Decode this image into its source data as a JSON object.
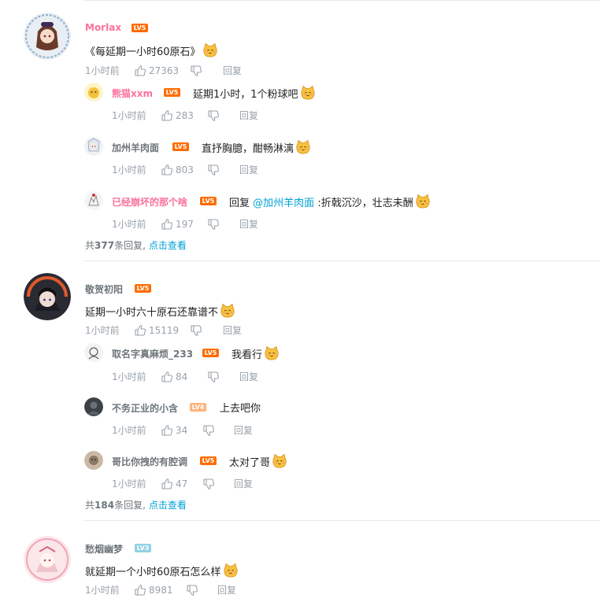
{
  "threads": [
    {
      "user": "Morlax",
      "level": "LV5",
      "comment_pre": "《每延期一小时60原石》",
      "time": "1小时前",
      "likes": "27363",
      "reply_label": "回复",
      "replies": [
        {
          "user": "熊猫xxm",
          "level": "LV5",
          "text": "延期1小时，1个粉球吧",
          "time": "1小时前",
          "likes": "283",
          "reply_label": "回复"
        },
        {
          "user": "加州羊肉面",
          "level": "LV5",
          "text": "直抒胸臆，酣畅淋漓",
          "time": "1小时前",
          "likes": "803",
          "reply_label": "回复"
        },
        {
          "user": "已经崩坏的那个啥",
          "level": "LV5",
          "text_prefix": "回复",
          "mention": "@加州羊肉面",
          "text": ":折戟沉沙，壮志未酬",
          "time": "1小时前",
          "likes": "197",
          "reply_label": "回复"
        }
      ],
      "more_prefix": "共",
      "more_count": "377",
      "more_suffix": "条回复,",
      "more_link": "点击查看"
    },
    {
      "user": "敬贺初阳",
      "level": "LV5",
      "comment_pre": "延期一小时六十原石还靠谱不",
      "time": "1小时前",
      "likes": "15119",
      "reply_label": "回复",
      "replies": [
        {
          "user": "取名字真麻烦_233",
          "level": "LV5",
          "text": "我看行",
          "time": "1小时前",
          "likes": "84",
          "reply_label": "回复"
        },
        {
          "user": "不务正业的小含",
          "level": "LV4",
          "text": "上去吧你",
          "time": "1小时前",
          "likes": "34",
          "reply_label": "回复"
        },
        {
          "user": "哥比你拽的有腔调",
          "level": "LV5",
          "text": "太对了哥",
          "time": "1小时前",
          "likes": "47",
          "reply_label": "回复"
        }
      ],
      "more_prefix": "共",
      "more_count": "184",
      "more_suffix": "条回复,",
      "more_link": "点击查看"
    },
    {
      "user": "愁烟幽梦",
      "level": "LV3",
      "comment_pre": "就延期一个小时60原石怎么样",
      "time": "1小时前",
      "likes": "8981",
      "reply_label": "回复"
    }
  ],
  "colors": {
    "pink_name": "#fb7299",
    "gray_name": "#6d757a",
    "meta": "#99a2aa",
    "link": "#00a1d6",
    "lv5": "#ff6c00",
    "lv4": "#ffb37c",
    "lv3": "#92d1e5"
  },
  "icons": {
    "like": "thumb-up-icon",
    "dislike": "thumb-down-icon",
    "emoji": "cat-face-emoji-icon"
  }
}
